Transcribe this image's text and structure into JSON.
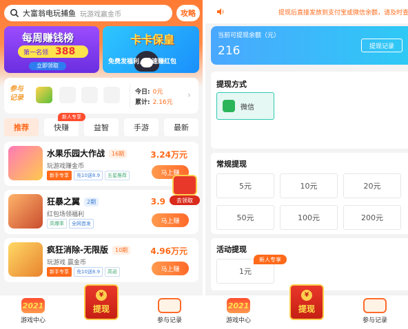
{
  "left": {
    "search": {
      "keyword": "大富翁电玩捕鱼",
      "placeholder": "玩游戏赢金币"
    },
    "guide_button": "攻略",
    "banners": {
      "weekly": {
        "title": "每周赚钱榜",
        "rank_label": "第一名领",
        "amount": "388",
        "cta": "立即领取"
      },
      "card": {
        "title": "卡卡保皇",
        "subtitle": "免费发福利，快速赚红包"
      }
    },
    "records": {
      "label": "参与记录",
      "today_label": "今日:",
      "today_value": "0元",
      "total_label": "累计:",
      "total_value": "2.16元"
    },
    "tabs": [
      "推荐",
      "快赚",
      "益智",
      "手游",
      "最新"
    ],
    "tab_badge": "新人专享",
    "games": [
      {
        "name": "水果乐园大作战",
        "period": "16期",
        "subtitle": "玩游戏赚金币",
        "tags": [
          "新手专享",
          "充10送8.9",
          "五星推荐"
        ],
        "reward": "3.24万元",
        "cta": "马上赚"
      },
      {
        "name": "狂暴之翼",
        "period": "2期",
        "subtitle": "红包场领福利",
        "tags": [
          "高爆率",
          "全网首发"
        ],
        "reward": "3.9",
        "cta": "马上赚"
      },
      {
        "name": "疯狂消除-无限版",
        "period": "10期",
        "subtitle": "玩游戏 赢金币",
        "tags": [
          "新手专享",
          "充10送8.9",
          "高返"
        ],
        "reward": "4.96万元",
        "cta": "马上赚"
      }
    ],
    "float_gift": "去领取"
  },
  "bottom_nav": {
    "game_center": "游戏中心",
    "withdraw": "提现",
    "records": "参与记录",
    "icon_text": "2021"
  },
  "right": {
    "notice": "提现后直接发放到支付宝或微信余额，请及时查收",
    "balance": {
      "label": "当前可提现余额（元）",
      "amount": "216",
      "record_button": "提现记录"
    },
    "method": {
      "title": "提现方式",
      "option": "微信"
    },
    "regular": {
      "title": "常规提现",
      "amounts": [
        "5元",
        "10元",
        "20元",
        "50元",
        "100元",
        "200元"
      ]
    },
    "activity": {
      "title": "活动提现",
      "amount": "1元",
      "badge": "新人专享"
    }
  }
}
